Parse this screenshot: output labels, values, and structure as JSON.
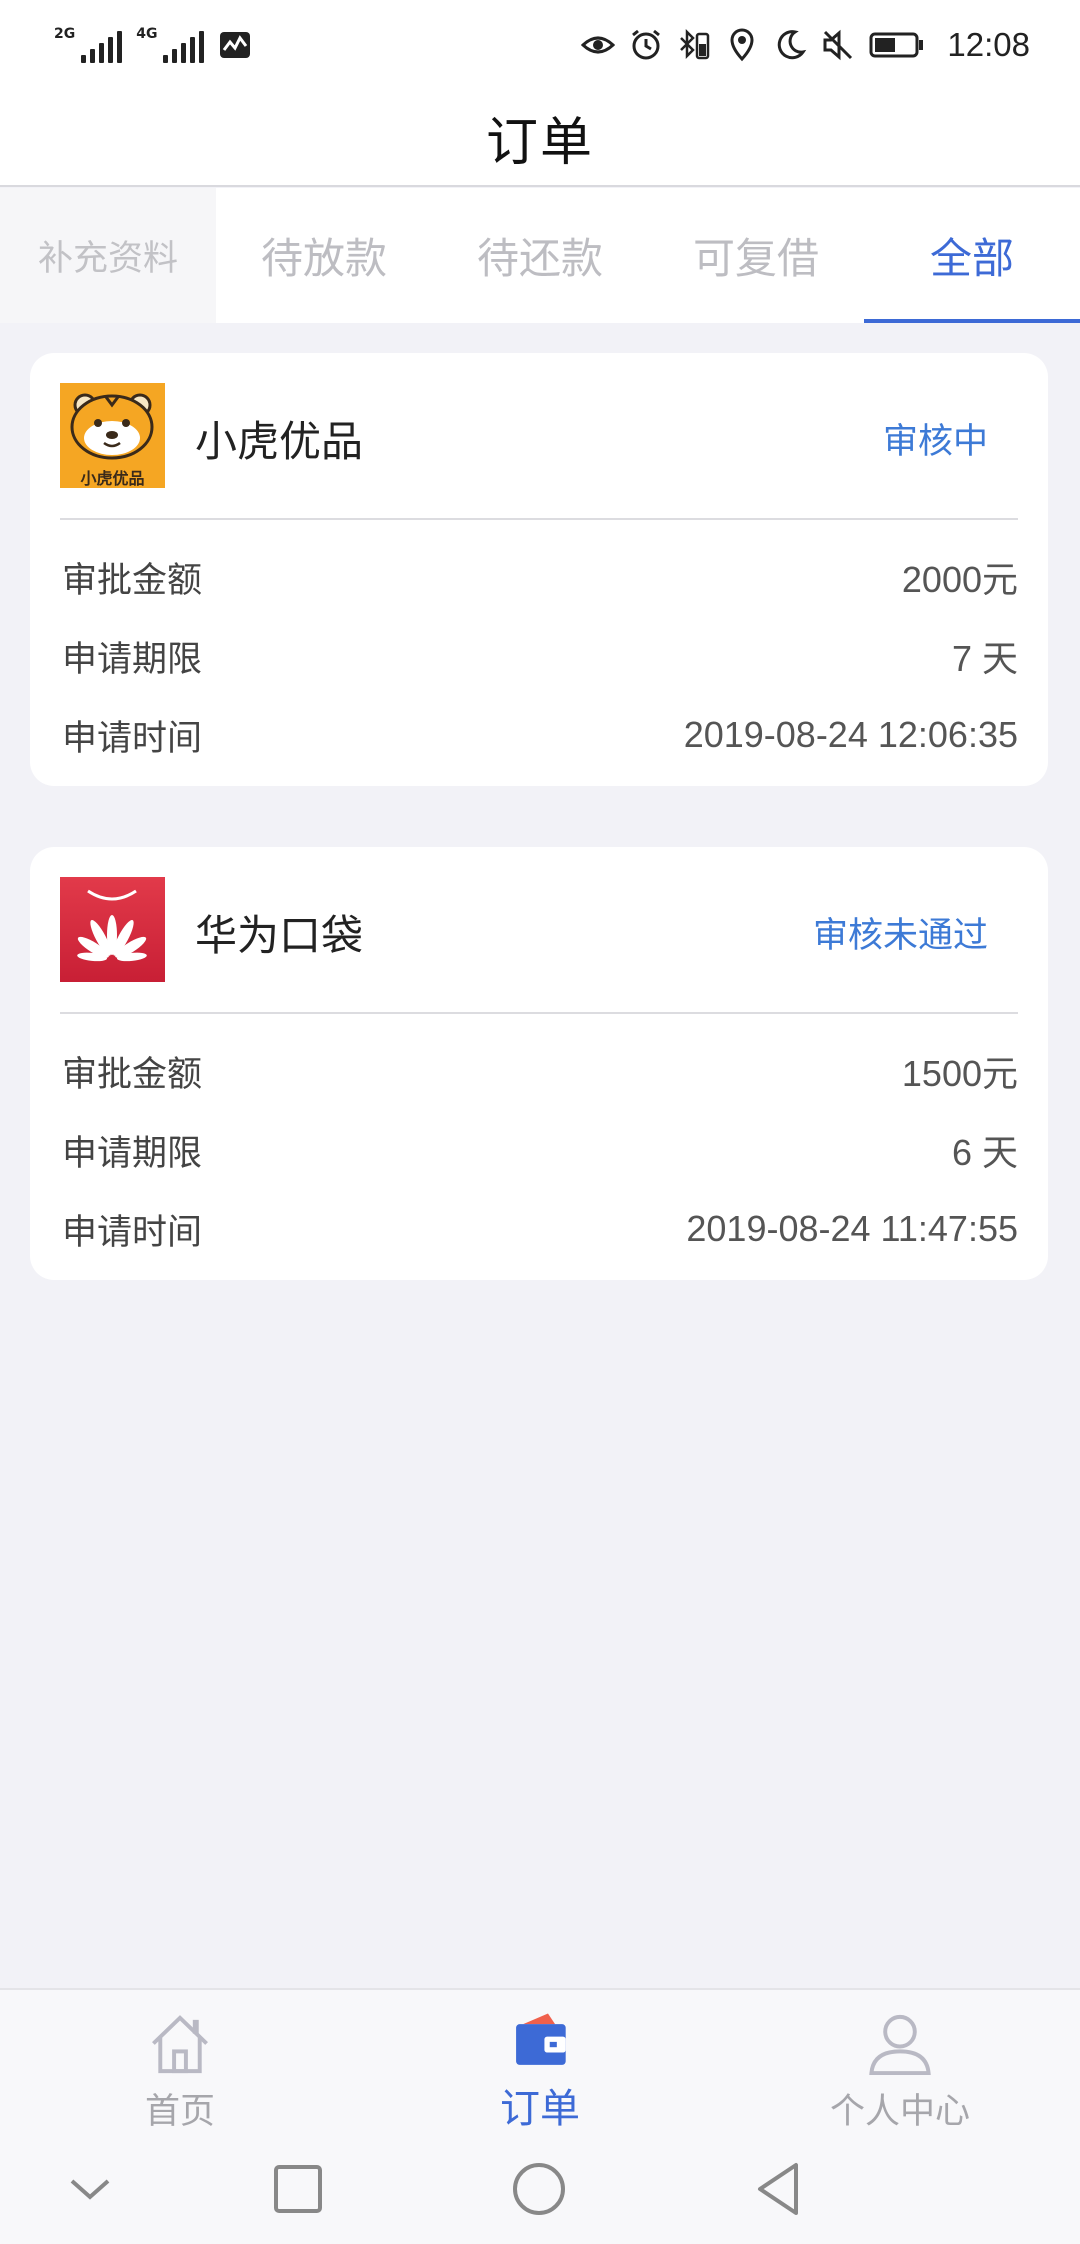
{
  "status_bar": {
    "net1": "2G",
    "net2": "4G",
    "time": "12:08"
  },
  "header": {
    "title": "订单"
  },
  "tabs": [
    {
      "label": "补充资料"
    },
    {
      "label": "待放款"
    },
    {
      "label": "待还款"
    },
    {
      "label": "可复借"
    },
    {
      "label": "全部",
      "active": true
    }
  ],
  "orders": [
    {
      "brand": "小虎优品",
      "logo_text": "小虎优品",
      "status": "审核中",
      "rows": [
        {
          "label": "审批金额",
          "value": "2000元"
        },
        {
          "label": "申请期限",
          "value": "7 天"
        },
        {
          "label": "申请时间",
          "value": "2019-08-24 12:06:35"
        }
      ]
    },
    {
      "brand": "华为口袋",
      "status": "审核未通过",
      "rows": [
        {
          "label": "审批金额",
          "value": "1500元"
        },
        {
          "label": "申请期限",
          "value": "6 天"
        },
        {
          "label": "申请时间",
          "value": "2019-08-24 11:47:55"
        }
      ]
    }
  ],
  "bottom_nav": [
    {
      "label": "首页",
      "icon": "home-icon"
    },
    {
      "label": "订单",
      "icon": "wallet-icon",
      "active": true
    },
    {
      "label": "个人中心",
      "icon": "user-icon"
    }
  ],
  "colors": {
    "accent": "#3d6ad6",
    "status_blue": "#3d7ad6",
    "background": "#f2f2f7",
    "tiger_orange": "#f5a623",
    "huawei_red": "#d7263d"
  }
}
